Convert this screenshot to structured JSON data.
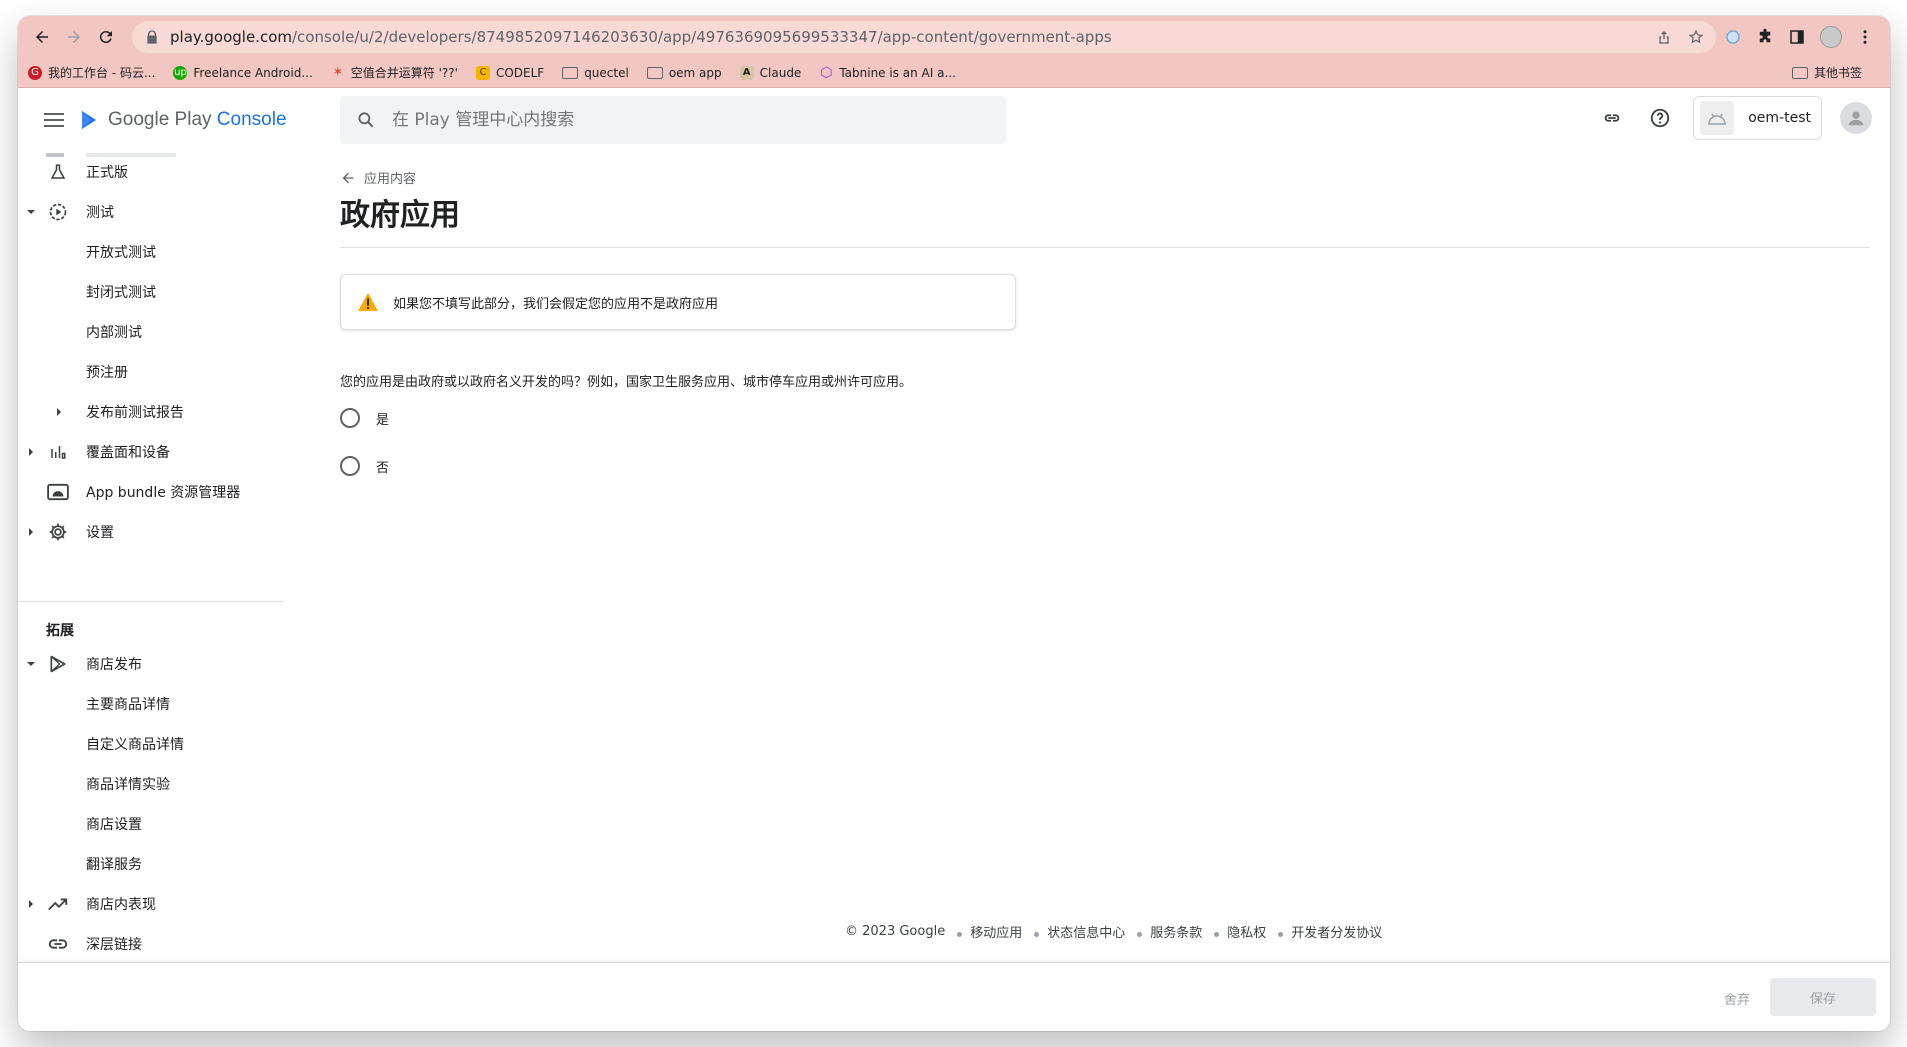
{
  "browser": {
    "url_domain": "play.google.com",
    "url_path": "/console/u/2/developers/8749852097146203630/app/4976369095699533347/app-content/government-apps",
    "bookmarks": [
      {
        "label": "我的工作台 - 码云...",
        "icon": "gitee-icon",
        "color": "#c71d23"
      },
      {
        "label": "Freelance Android...",
        "icon": "upwork-icon",
        "color": "#14a800"
      },
      {
        "label": "空值合并运算符 '??'",
        "icon": "js-icon",
        "color": "#e34c26"
      },
      {
        "label": "CODELF",
        "icon": "codelf-icon",
        "color": "#f4b400"
      },
      {
        "label": "quectel",
        "icon": "folder-icon",
        "color": "#5f6368"
      },
      {
        "label": "oem app",
        "icon": "folder-icon",
        "color": "#5f6368"
      },
      {
        "label": "Claude",
        "icon": "anthropic-icon",
        "color": "#202124"
      },
      {
        "label": "Tabnine is an AI a...",
        "icon": "tabnine-icon",
        "color": "#7b3fe4"
      }
    ],
    "other_bookmarks": "其他书签"
  },
  "header": {
    "logo_google": "Google Play",
    "logo_console": "Console",
    "search_placeholder": "在 Play 管理中心内搜索",
    "app_name": "oem-test"
  },
  "sidebar": {
    "items": [
      {
        "label": "正式版",
        "icon": "flask-icon",
        "caret": ""
      },
      {
        "label": "测试",
        "icon": "play-circle-icon",
        "caret": "down"
      },
      {
        "label": "开放式测试",
        "sub": true
      },
      {
        "label": "封闭式测试",
        "sub": true
      },
      {
        "label": "内部测试",
        "sub": true
      },
      {
        "label": "预注册",
        "sub": true
      },
      {
        "label": "发布前测试报告",
        "sub": true,
        "caret": "right"
      },
      {
        "label": "覆盖面和设备",
        "icon": "bar-chart-icon",
        "caret": "right"
      },
      {
        "label": "App bundle 资源管理器",
        "icon": "android-icon",
        "caret": ""
      },
      {
        "label": "设置",
        "icon": "gear-icon",
        "caret": "right"
      }
    ],
    "section_title": "拓展",
    "items2": [
      {
        "label": "商店发布",
        "icon": "play-store-icon",
        "caret": "down"
      },
      {
        "label": "主要商品详情",
        "sub": true
      },
      {
        "label": "自定义商品详情",
        "sub": true
      },
      {
        "label": "商品详情实验",
        "sub": true
      },
      {
        "label": "商店设置",
        "sub": true
      },
      {
        "label": "翻译服务",
        "sub": true
      },
      {
        "label": "商店内表现",
        "icon": "trending-up-icon",
        "caret": "right"
      },
      {
        "label": "深层链接",
        "icon": "link-icon",
        "caret": ""
      }
    ]
  },
  "main": {
    "back_label": "应用内容",
    "title": "政府应用",
    "warning": "如果您不填写此部分，我们会假定您的应用不是政府应用",
    "question": "您的应用是由政府或以政府名义开发的吗？例如，国家卫生服务应用、城市停车应用或州许可应用。",
    "options": [
      "是",
      "否"
    ]
  },
  "footer": {
    "copyright": "© 2023 Google",
    "links": [
      "移动应用",
      "状态信息中心",
      "服务条款",
      "隐私权",
      "开发者分发协议"
    ]
  },
  "actions": {
    "discard": "舍弃",
    "save": "保存"
  }
}
